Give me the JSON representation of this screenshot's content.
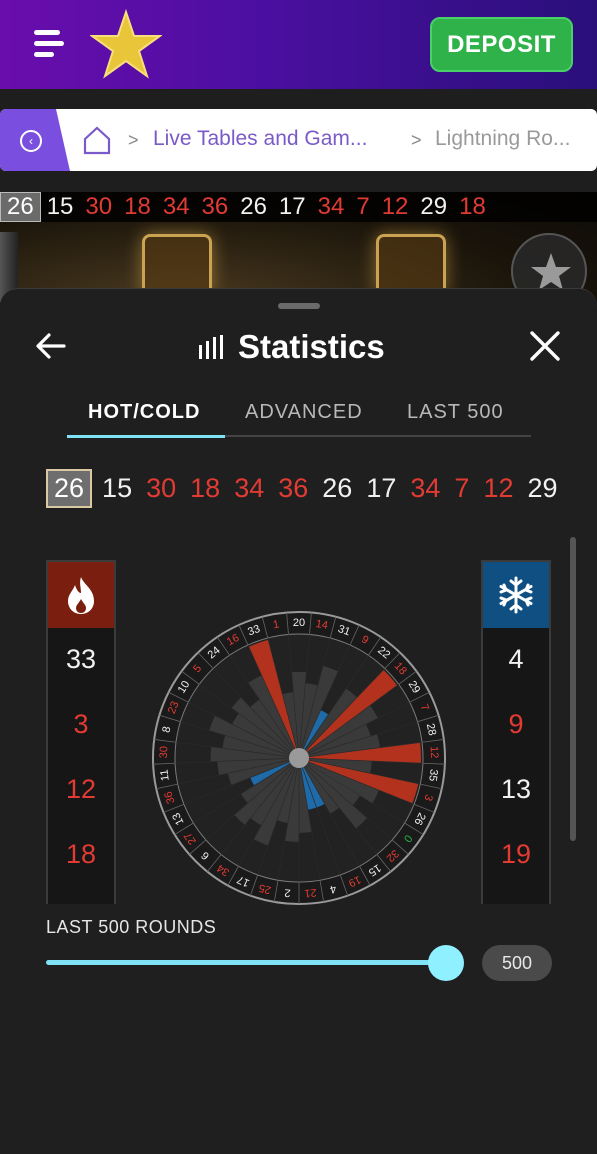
{
  "header": {
    "deposit_label": "DEPOSIT",
    "brand_color": "#6a0dad",
    "deposit_color": "#2fb24a"
  },
  "breadcrumb": {
    "items": [
      "Live Tables and Gam...",
      "Lightning Ro..."
    ],
    "separator": ">"
  },
  "game_history": [
    {
      "n": "26",
      "c": "white"
    },
    {
      "n": "15",
      "c": "white"
    },
    {
      "n": "30",
      "c": "red"
    },
    {
      "n": "18",
      "c": "red"
    },
    {
      "n": "34",
      "c": "red"
    },
    {
      "n": "36",
      "c": "red"
    },
    {
      "n": "26",
      "c": "white"
    },
    {
      "n": "17",
      "c": "white"
    },
    {
      "n": "34",
      "c": "red"
    },
    {
      "n": "7",
      "c": "red"
    },
    {
      "n": "12",
      "c": "red"
    },
    {
      "n": "29",
      "c": "white"
    },
    {
      "n": "18",
      "c": "red"
    }
  ],
  "stats": {
    "title": "Statistics",
    "tabs": [
      "HOT/COLD",
      "ADVANCED",
      "LAST 500"
    ],
    "active_tab": 0,
    "recent": [
      {
        "n": "26",
        "c": "white"
      },
      {
        "n": "15",
        "c": "white"
      },
      {
        "n": "30",
        "c": "red"
      },
      {
        "n": "18",
        "c": "red"
      },
      {
        "n": "34",
        "c": "red"
      },
      {
        "n": "36",
        "c": "red"
      },
      {
        "n": "26",
        "c": "white"
      },
      {
        "n": "17",
        "c": "white"
      },
      {
        "n": "34",
        "c": "red"
      },
      {
        "n": "7",
        "c": "red"
      },
      {
        "n": "12",
        "c": "red"
      },
      {
        "n": "29",
        "c": "white"
      }
    ],
    "hot": [
      {
        "n": "33",
        "c": "white"
      },
      {
        "n": "3",
        "c": "red"
      },
      {
        "n": "12",
        "c": "red"
      },
      {
        "n": "18",
        "c": "red"
      }
    ],
    "cold": [
      {
        "n": "4",
        "c": "white"
      },
      {
        "n": "9",
        "c": "red"
      },
      {
        "n": "13",
        "c": "white"
      },
      {
        "n": "19",
        "c": "red"
      }
    ],
    "hot_color": "#7a1e0f",
    "cold_color": "#0f4f82",
    "wheel_order": [
      "0",
      "32",
      "15",
      "19",
      "4",
      "21",
      "2",
      "25",
      "17",
      "34",
      "6",
      "27",
      "13",
      "36",
      "11",
      "30",
      "8",
      "23",
      "10",
      "5",
      "24",
      "16",
      "33",
      "1",
      "20",
      "14",
      "31",
      "9",
      "22",
      "18",
      "29",
      "7",
      "28",
      "12",
      "35",
      "3",
      "26"
    ],
    "red_numbers": [
      "1",
      "3",
      "5",
      "7",
      "9",
      "12",
      "14",
      "16",
      "18",
      "19",
      "21",
      "23",
      "25",
      "27",
      "30",
      "32",
      "34",
      "36"
    ],
    "hot_set": [
      "33",
      "3",
      "12",
      "18"
    ],
    "cold_set": [
      "4",
      "9",
      "13",
      "19"
    ],
    "slider": {
      "label": "LAST 500 ROUNDS",
      "value": "500",
      "fraction": 1.0
    }
  }
}
